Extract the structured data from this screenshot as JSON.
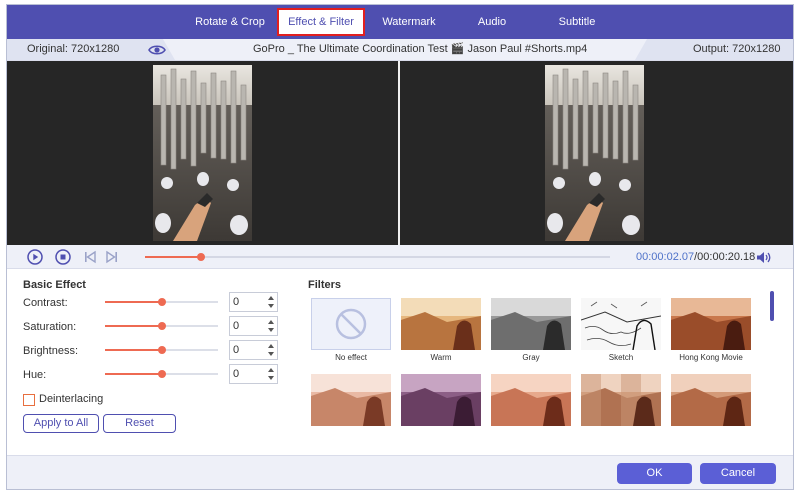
{
  "tabs": [
    {
      "label": "Rotate & Crop"
    },
    {
      "label": "Effect & Filter",
      "active": true
    },
    {
      "label": "Watermark"
    },
    {
      "label": "Audio"
    },
    {
      "label": "Subtitle"
    }
  ],
  "info": {
    "original": "Original: 720x1280",
    "filename": "GoPro _ The Ultimate Coordination Test  🎬 Jason Paul #Shorts.mp4",
    "output": "Output: 720x1280",
    "eye_icon": "eye-icon"
  },
  "player": {
    "current_time": "00:00:02.07",
    "total_time": "/00:00:20.18",
    "progress": 0.12,
    "icons": [
      "play-icon",
      "stop-icon",
      "previous-frame-icon",
      "next-frame-icon",
      "volume-icon"
    ]
  },
  "basic_effect": {
    "title": "Basic Effect",
    "adjustments": [
      {
        "label": "Contrast:",
        "value": "0",
        "level": 0.5
      },
      {
        "label": "Saturation:",
        "value": "0",
        "level": 0.5
      },
      {
        "label": "Brightness:",
        "value": "0",
        "level": 0.5
      },
      {
        "label": "Hue:",
        "value": "0",
        "level": 0.5
      }
    ],
    "deinterlacing": {
      "label": "Deinterlacing",
      "checked": false
    },
    "apply_all_label": "Apply to All",
    "reset_label": "Reset"
  },
  "filters": {
    "title": "Filters",
    "items": [
      {
        "label": "No effect"
      },
      {
        "label": "Warm"
      },
      {
        "label": "Gray"
      },
      {
        "label": "Sketch"
      },
      {
        "label": "Hong Kong Movie"
      },
      {
        "label": ""
      },
      {
        "label": ""
      },
      {
        "label": ""
      },
      {
        "label": ""
      },
      {
        "label": ""
      }
    ]
  },
  "footer": {
    "ok_label": "OK",
    "cancel_label": "Cancel"
  },
  "colors": {
    "accent": "#4f4fb0",
    "highlight": "#e21f1f",
    "slider": "#ee6a52",
    "time": "#4f72c9"
  }
}
